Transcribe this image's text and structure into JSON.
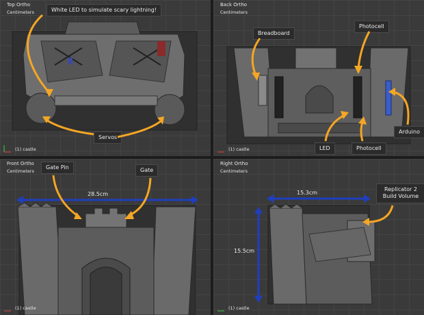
{
  "viewports": {
    "top": {
      "title": "Top Ortho",
      "units": "Centimeters",
      "object": "(1) castle"
    },
    "back": {
      "title": "Back Ortho",
      "units": "Centimeters",
      "object": "(1) castle"
    },
    "front": {
      "title": "Front Ortho",
      "units": "Centimeters",
      "object": "(1) castle"
    },
    "right": {
      "title": "Right Ortho",
      "units": "Centimeters",
      "object": "(1) castle"
    }
  },
  "callouts": {
    "white_led": "White LED to simulate scary lightning!",
    "servos": "Servos",
    "breadboard": "Breadboard",
    "photocell_top": "Photocell",
    "led": "LED",
    "photocell_bottom": "Photocell",
    "arduino": "Arduino",
    "gate_pin": "Gate Pin",
    "gate": "Gate",
    "build_volume": "Replicator 2 Build Volume"
  },
  "dimensions": {
    "front_width": "28.5cm",
    "right_width": "15.3cm",
    "right_height": "15.5cm"
  },
  "colors": {
    "callout_arrow": "#f5a623",
    "dimension_arrow": "#1f3fbf",
    "model_gray": "#6e6e6e"
  }
}
